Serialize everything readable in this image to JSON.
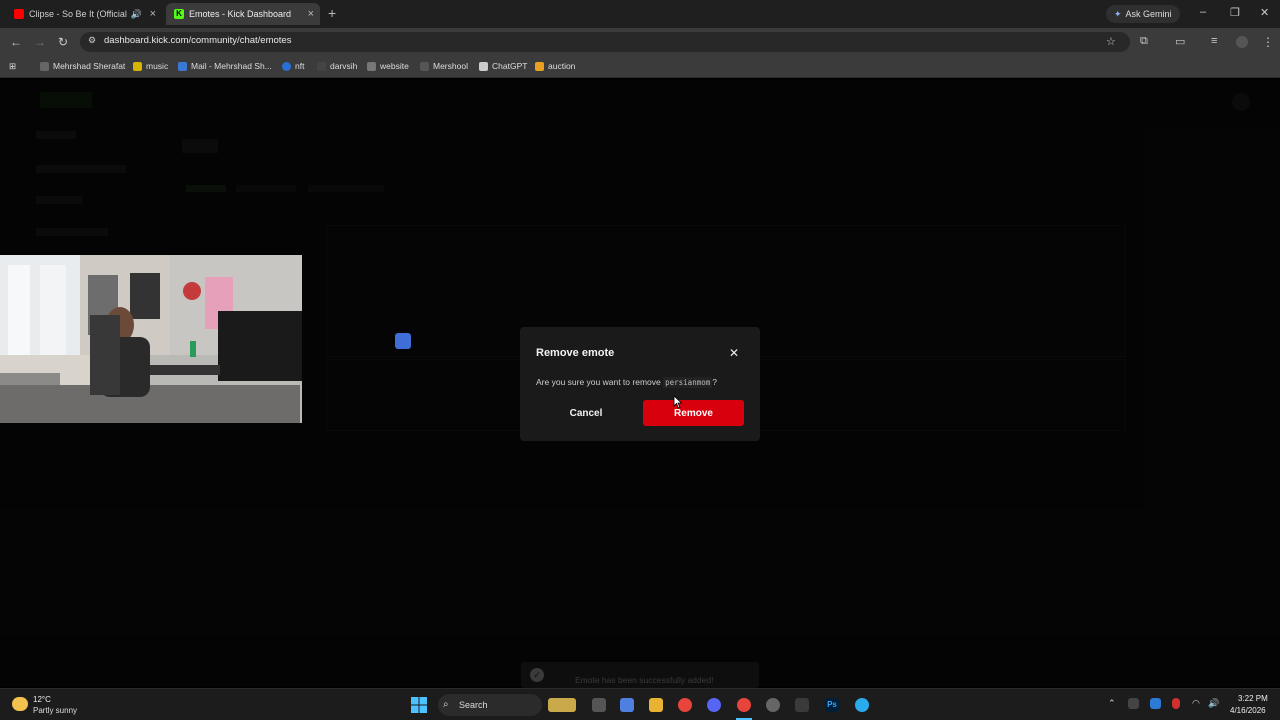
{
  "browser": {
    "tabs": [
      {
        "title": "Clipse - So Be It (Official M"
      },
      {
        "title": "Emotes - Kick Dashboard"
      }
    ],
    "ask_gemini": "Ask Gemini",
    "url": "dashboard.kick.com/community/chat/emotes",
    "bookmarks": [
      "Mehrshad Sherafat",
      "music",
      "Mail - Mehrshad Sh...",
      "nft",
      "darvsih",
      "website",
      "Mershool",
      "ChatGPT",
      "auction"
    ]
  },
  "modal": {
    "title": "Remove emote",
    "message": "Are you sure you want to remove",
    "emote_name": "persianmom",
    "message_suffix": "?",
    "cancel_label": "Cancel",
    "remove_label": "Remove"
  },
  "toast": {
    "message": "Emote has been successfully added!"
  },
  "taskbar": {
    "temperature": "12°C",
    "weather": "Partly sunny",
    "search_label": "Search",
    "time": "3:22 PM",
    "date": "4/16/2026"
  },
  "colors": {
    "remove_button": "#d9000d",
    "kick_brand": "#53fc18",
    "youtube": "#ff0000"
  }
}
